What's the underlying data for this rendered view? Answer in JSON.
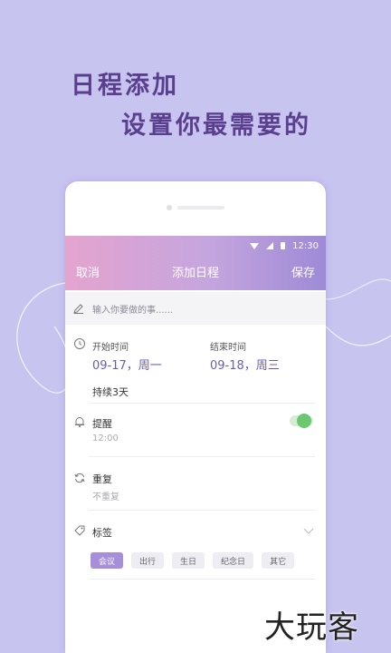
{
  "promo": {
    "line1": "日程添加",
    "line2": "设置你最需要的"
  },
  "status_bar": {
    "time": "12:30"
  },
  "nav": {
    "cancel": "取消",
    "title": "添加日程",
    "save": "保存"
  },
  "event_input": {
    "placeholder": "输入你要做的事......"
  },
  "time": {
    "start_label": "开始时间",
    "start_value": "09-17，周一",
    "end_label": "结束时间",
    "end_value": "09-18，周三",
    "duration": "持续3天"
  },
  "reminder": {
    "label": "提醒",
    "value": "12:00",
    "enabled": true
  },
  "repeat": {
    "label": "重复",
    "value": "不重复"
  },
  "tags": {
    "label": "标签",
    "items": [
      {
        "label": "会议",
        "selected": true
      },
      {
        "label": "出行",
        "selected": false
      },
      {
        "label": "生日",
        "selected": false
      },
      {
        "label": "纪念日",
        "selected": false
      },
      {
        "label": "其它",
        "selected": false
      }
    ]
  },
  "watermark": "大玩客",
  "colors": {
    "background": "#c8c4f0",
    "accent": "#6b5bb3",
    "toggle_on": "#6cc86e",
    "header_gradient": [
      "#e4a4cf",
      "#9e8ad6"
    ]
  },
  "icons": [
    "pen-icon",
    "clock-icon",
    "bell-icon",
    "repeat-icon",
    "tag-icon",
    "chevron-down-icon",
    "wifi-icon",
    "signal-icon",
    "battery-icon"
  ]
}
